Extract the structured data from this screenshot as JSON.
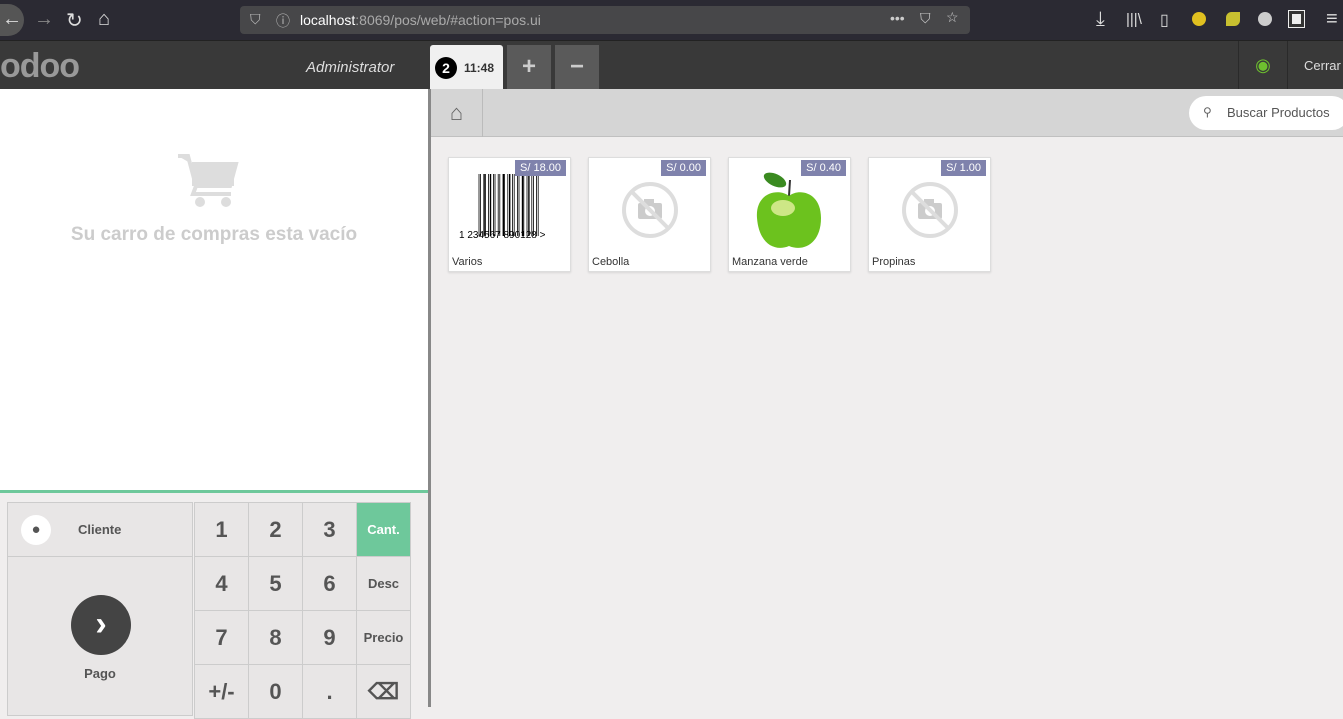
{
  "browser": {
    "url_host": "localhost",
    "url_rest": ":8069/pos/web/#action=pos.ui"
  },
  "header": {
    "logo": "odoo",
    "user": "Administrator",
    "order_number": "2",
    "order_time": "11:48",
    "add_label": "+",
    "remove_label": "−",
    "close_label": "Cerrar"
  },
  "cart": {
    "empty_text": "Su carro de compras esta vacío"
  },
  "pad": {
    "customer": "Cliente",
    "payment": "Pago",
    "keys": [
      "1",
      "2",
      "3",
      "Cant.",
      "4",
      "5",
      "6",
      "Desc",
      "7",
      "8",
      "9",
      "Precio",
      "+/-",
      "0",
      ".",
      "⌫"
    ]
  },
  "search": {
    "placeholder": "Buscar Productos"
  },
  "products": [
    {
      "name": "Varios",
      "price": "S/ 18.00",
      "barcode": "1 234567 890128 >"
    },
    {
      "name": "Cebolla",
      "price": "S/ 0.00"
    },
    {
      "name": "Manzana verde",
      "price": "S/ 0.40"
    },
    {
      "name": "Propinas",
      "price": "S/ 1.00"
    }
  ],
  "colors": {
    "accent": "#6ec89b",
    "price_badge": "#7f82ac"
  }
}
